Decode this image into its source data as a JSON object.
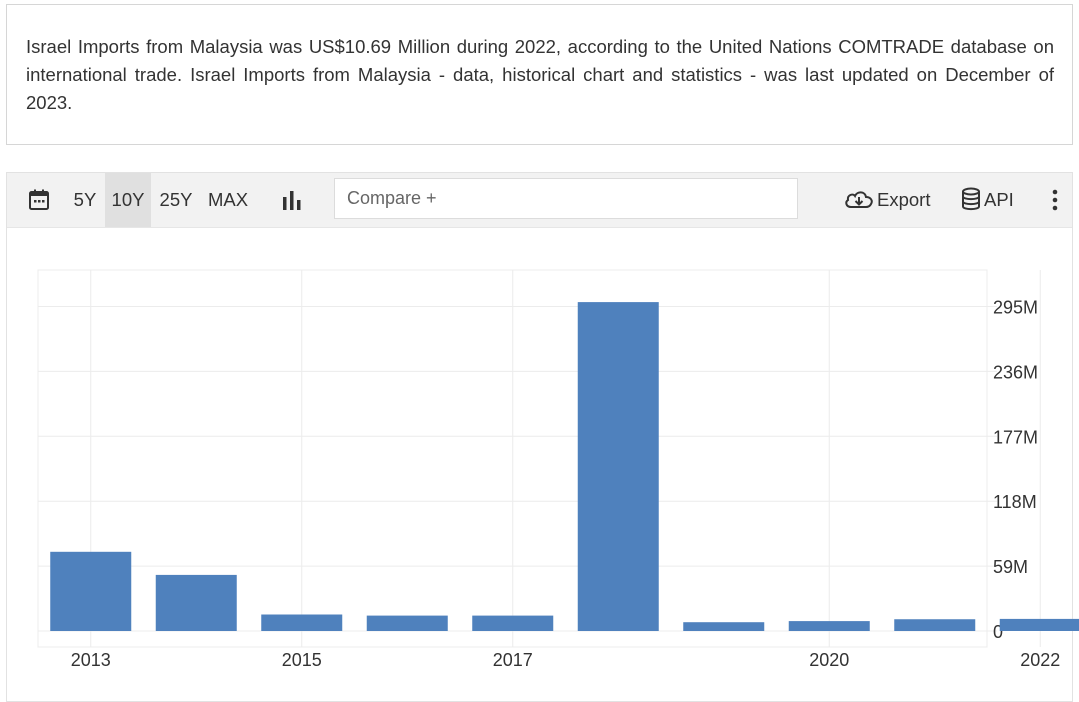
{
  "description": "Israel Imports from Malaysia was US$10.69 Million during 2022, according to the United Nations COMTRADE database on international trade. Israel Imports from Malaysia - data, historical chart and statistics - was last updated on December of 2023.",
  "toolbar": {
    "range_buttons": [
      "5Y",
      "10Y",
      "25Y",
      "MAX"
    ],
    "active_range": "10Y",
    "compare_placeholder": "Compare +",
    "export_label": "Export",
    "api_label": "API"
  },
  "colors": {
    "bar": "#4f81bd",
    "grid": "#ececec",
    "axis_text": "#333333"
  },
  "chart_data": {
    "type": "bar",
    "categories": [
      "2013",
      "2014",
      "2015",
      "2016",
      "2017",
      "2018",
      "2019",
      "2020",
      "2021",
      "2022"
    ],
    "values": [
      72,
      51,
      15,
      14,
      14,
      299,
      8,
      9,
      10.69,
      11
    ],
    "x_tick_labels": [
      "2013",
      "2015",
      "2017",
      "2020",
      "2022"
    ],
    "y_ticks": [
      0,
      59,
      118,
      177,
      236,
      295
    ],
    "y_tick_labels": [
      "0",
      "59M",
      "118M",
      "177M",
      "236M",
      "295M"
    ],
    "ylim": [
      0,
      315
    ],
    "y_axis_position": "right",
    "grid": true
  }
}
